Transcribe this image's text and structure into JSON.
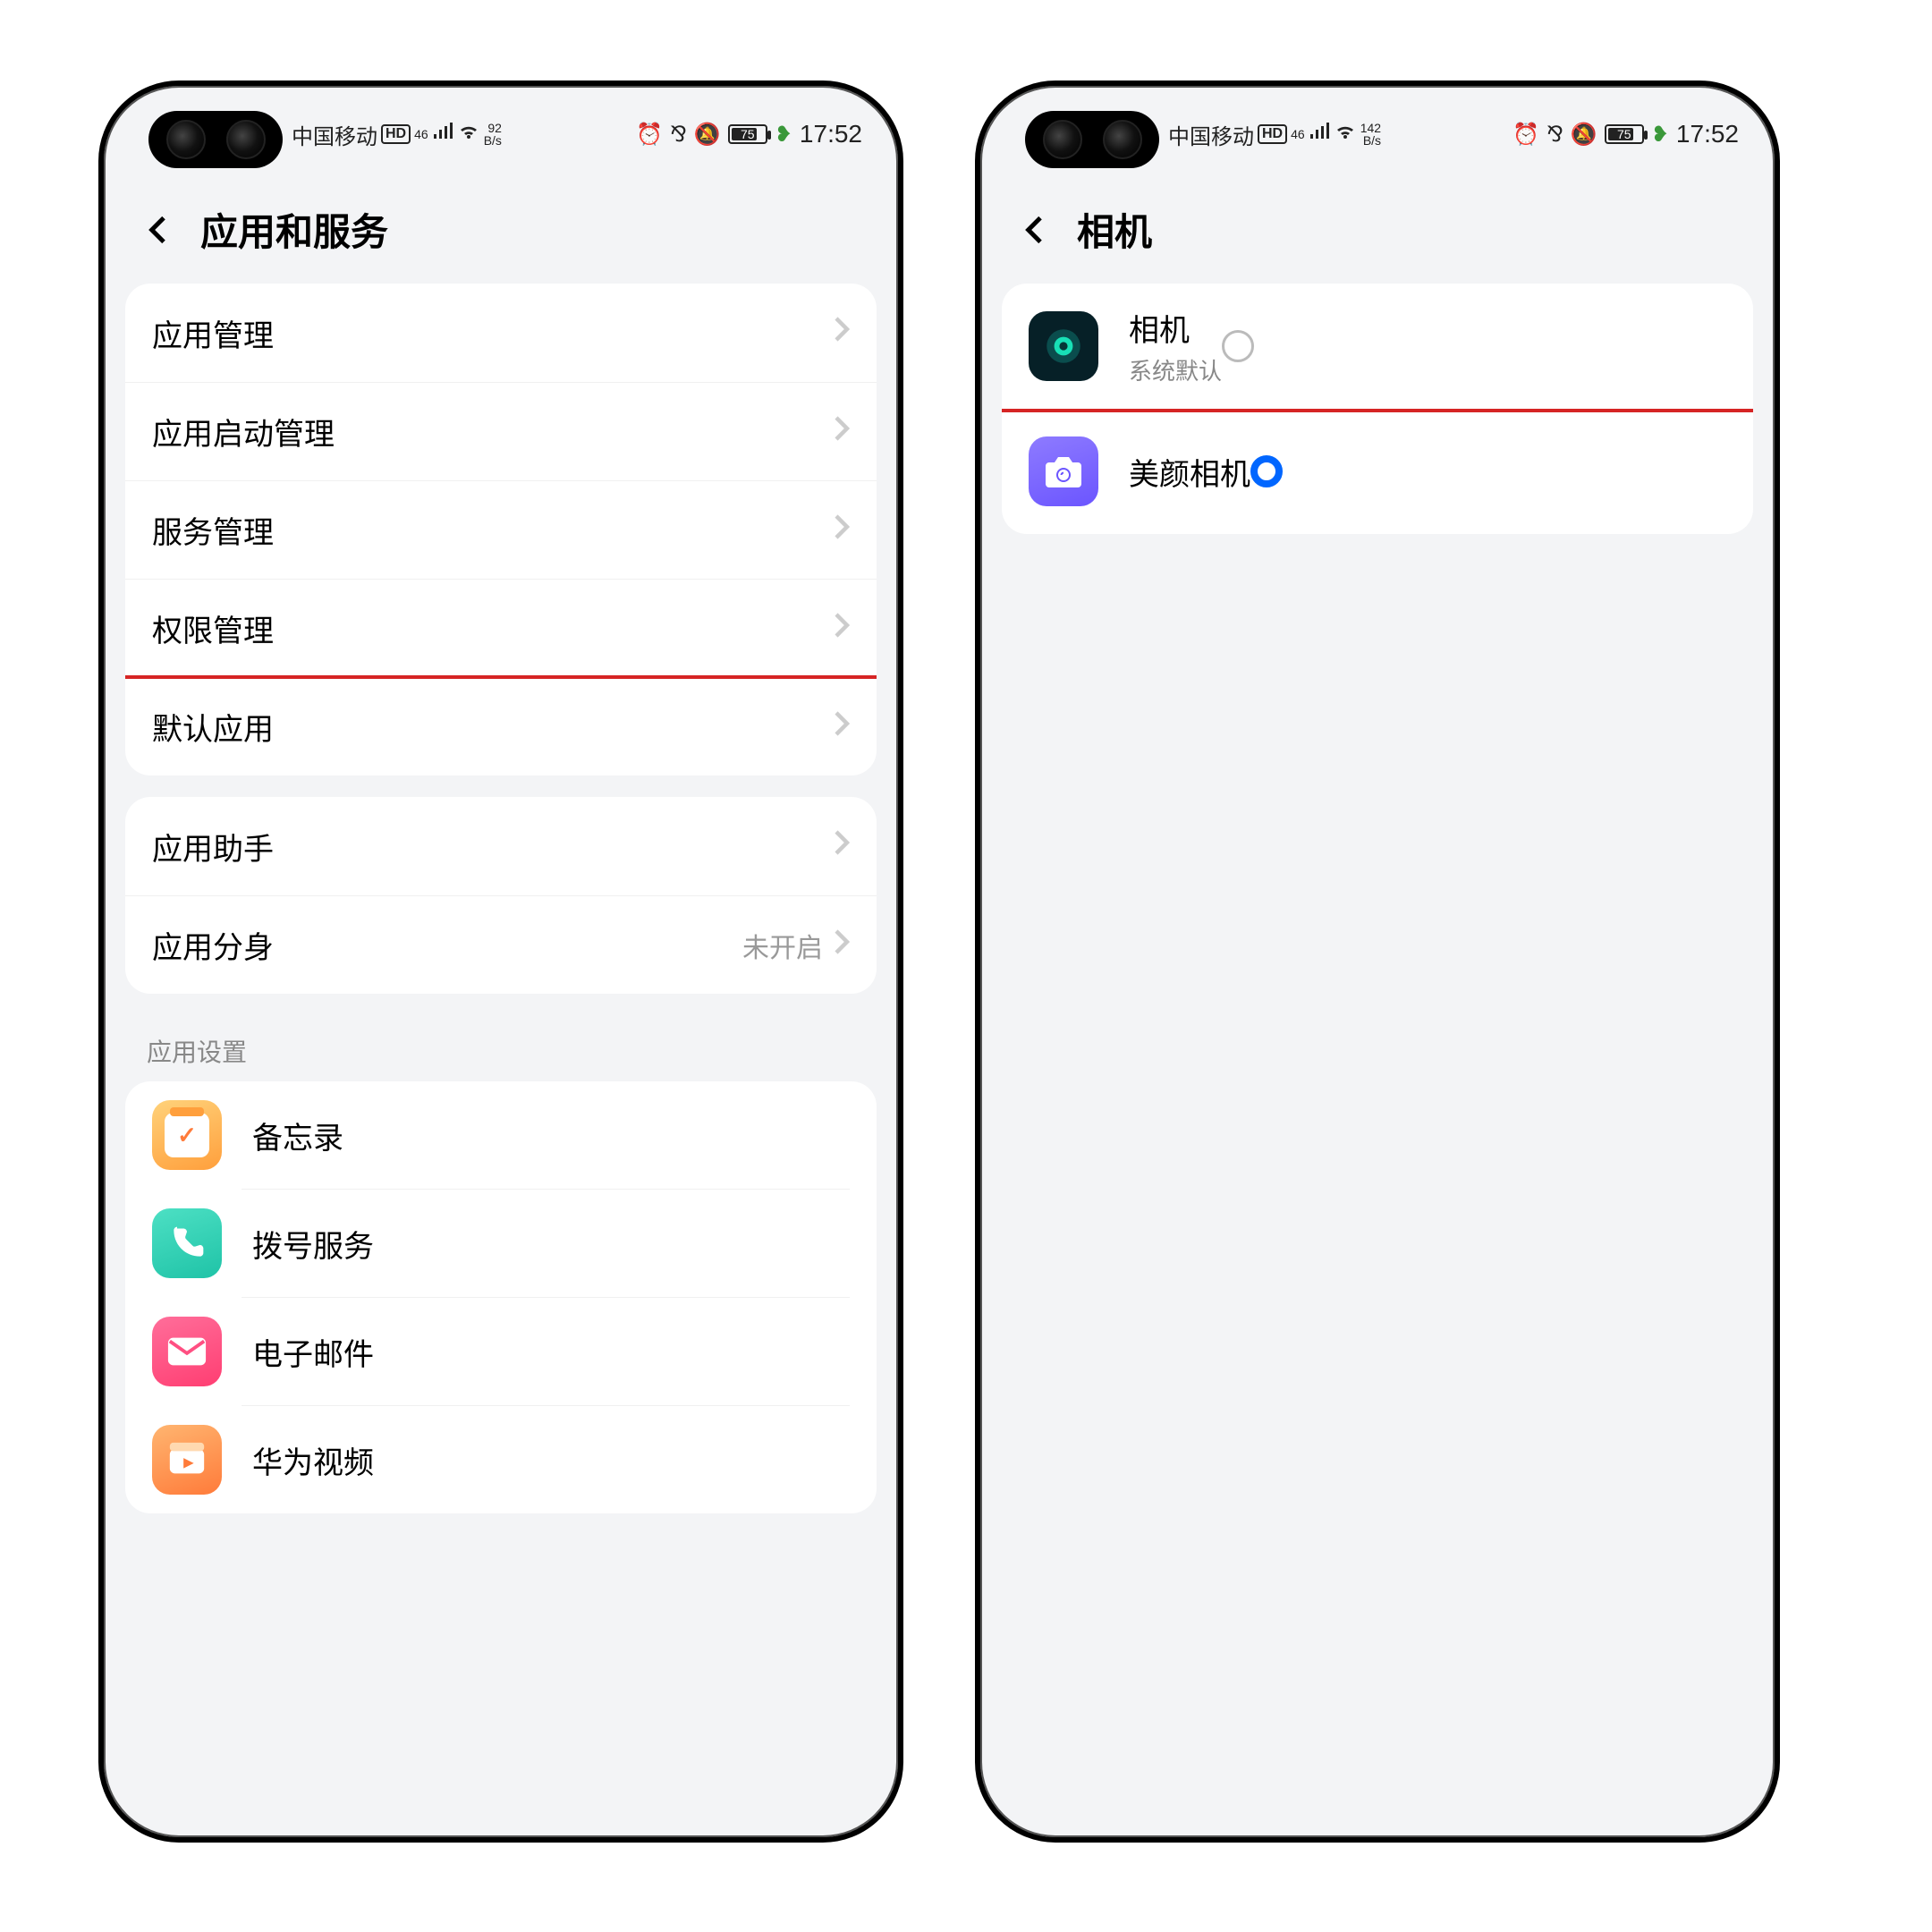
{
  "status": {
    "carrier": "中国移动",
    "hd": "HD",
    "net_tag": "46",
    "speed_top": "92",
    "speed_bottom": "B/s",
    "battery": "75",
    "time": "17:52",
    "speed2_top": "142",
    "speed2_bottom": "B/s"
  },
  "left_screen": {
    "title": "应用和服务",
    "group1": {
      "items": [
        {
          "label": "应用管理"
        },
        {
          "label": "应用启动管理"
        },
        {
          "label": "服务管理"
        },
        {
          "label": "权限管理"
        },
        {
          "label": "默认应用"
        }
      ]
    },
    "group2": {
      "items": [
        {
          "label": "应用助手"
        },
        {
          "label": "应用分身",
          "value": "未开启"
        }
      ]
    },
    "section_label": "应用设置",
    "app_list": [
      {
        "label": "备忘录"
      },
      {
        "label": "拨号服务"
      },
      {
        "label": "电子邮件"
      },
      {
        "label": "华为视频"
      }
    ]
  },
  "right_screen": {
    "title": "相机",
    "options": [
      {
        "label": "相机",
        "sub": "系统默认",
        "selected": false
      },
      {
        "label": "美颜相机",
        "selected": true
      }
    ]
  }
}
